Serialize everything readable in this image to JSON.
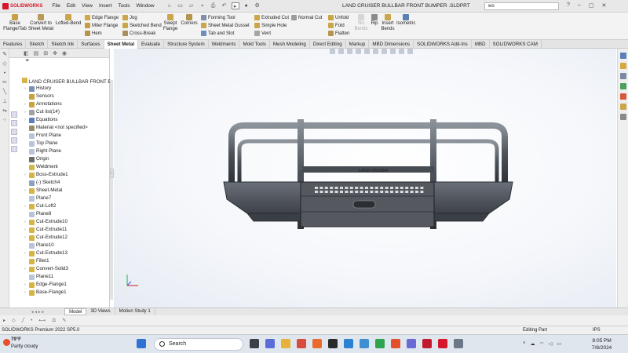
{
  "app": {
    "brand": "SOLIDWORKS",
    "doc_title": "LAND CRUISER BULLBAR FRONT BUMPER .SLDPRT",
    "search_placeholder": "wo"
  },
  "menu": [
    "File",
    "Edit",
    "View",
    "Insert",
    "Tools",
    "Window"
  ],
  "commands": {
    "base_flange_1": "Base",
    "base_flange_2": "Flange/Tab",
    "convert_1": "Convert to",
    "convert_2": "Sheet Metal",
    "lofted_bend": "Lofted-Bend",
    "edge_flange": "Edge Flange",
    "miter_flange": "Miter Flange",
    "hem": "Hem",
    "jog": "Jog",
    "sketched_bend": "Sketched Bend",
    "cross_break": "Cross-Break",
    "swept_flange_1": "Swept",
    "swept_flange_2": "Flange",
    "corners": "Corners",
    "forming_tool": "Forming Tool",
    "sheet_metal_gusset": "Sheet Metal Gusset",
    "tab_and_slot": "Tab and Slot",
    "extruded_cut": "Extruded Cut",
    "simple_hole": "Simple Hole",
    "vent": "Vent",
    "normal_cut": "Normal Cut",
    "unfold": "Unfold",
    "fold": "Fold",
    "flatten": "Flatten",
    "no_bends_1": "No",
    "no_bends_2": "Bends",
    "rip": "Rip",
    "insert_bends_1": "Insert",
    "insert_bends_2": "Bends",
    "isometric": "Isometric"
  },
  "tabs": [
    "Features",
    "Sketch",
    "Sketch Ink",
    "Surfaces",
    "Sheet Metal",
    "Evaluate",
    "Structure System",
    "Weldments",
    "Mold Tools",
    "Mesh Modeling",
    "Direct Editing",
    "Markup",
    "MBD Dimensions",
    "SOLIDWORKS Add-Ins",
    "MBD",
    "SOLIDWORKS CAM"
  ],
  "active_tab": "Sheet Metal",
  "tree": {
    "root": "LAND CRUISER BULLBAR FRONT B",
    "nodes": [
      {
        "label": "History",
        "arrow": "›",
        "color": "#7c8fb0"
      },
      {
        "label": "Sensors",
        "arrow": "",
        "color": "#c9a23c"
      },
      {
        "label": "Annotations",
        "arrow": "›",
        "color": "#c9a23c"
      },
      {
        "label": "Cut list(14)",
        "arrow": "›",
        "color": "#a2a2a2"
      },
      {
        "label": "Equations",
        "arrow": "›",
        "color": "#5a7dbb"
      },
      {
        "label": "Material <not specified>",
        "arrow": "",
        "color": "#9b8a6a"
      },
      {
        "label": "Front Plane",
        "arrow": "",
        "color": "#b8c4d8"
      },
      {
        "label": "Top Plane",
        "arrow": "",
        "color": "#b8c4d8"
      },
      {
        "label": "Right Plane",
        "arrow": "",
        "color": "#b8c4d8"
      },
      {
        "label": "Origin",
        "arrow": "",
        "color": "#6b6b6b"
      },
      {
        "label": "Weldment",
        "arrow": "",
        "color": "#d1b84c"
      },
      {
        "label": "Boss-Extrude1",
        "arrow": "›",
        "color": "#d6b445"
      },
      {
        "label": "(-) Sketch4",
        "arrow": "",
        "color": "#8da0c0"
      },
      {
        "label": "Sheet-Metal",
        "arrow": "›",
        "color": "#d6b445"
      },
      {
        "label": "Plane7",
        "arrow": "",
        "color": "#b8c4d8"
      },
      {
        "label": "Cut-Loft2",
        "arrow": "›",
        "color": "#d6b445"
      },
      {
        "label": "Plane8",
        "arrow": "",
        "color": "#b8c4d8"
      },
      {
        "label": "Cut-Extrude10",
        "arrow": "›",
        "color": "#d6b445"
      },
      {
        "label": "Cut-Extrude11",
        "arrow": "›",
        "color": "#d6b445"
      },
      {
        "label": "Cut-Extrude12",
        "arrow": "›",
        "color": "#d6b445"
      },
      {
        "label": "Plane10",
        "arrow": "",
        "color": "#b8c4d8"
      },
      {
        "label": "Cut-Extrude13",
        "arrow": "›",
        "color": "#d6b445"
      },
      {
        "label": "Fillet1",
        "arrow": "",
        "color": "#d6b445"
      },
      {
        "label": "Convert-Solid3",
        "arrow": "›",
        "color": "#d6b445"
      },
      {
        "label": "Plane11",
        "arrow": "",
        "color": "#b8c4d8"
      },
      {
        "label": "Edge-Flange1",
        "arrow": "›",
        "color": "#d6b445"
      },
      {
        "label": "Base-Flange1",
        "arrow": "›",
        "color": "#d6b445"
      }
    ]
  },
  "model": {
    "bumper_logo": "LAND CRUISER"
  },
  "view_tabs": [
    "Model",
    "3D Views",
    "Motion Study 1"
  ],
  "status": {
    "version": "SOLIDWORKS Premium 2022 SP5.0",
    "mode": "Editing Part",
    "units": "IPS"
  },
  "taskbar": {
    "temp": "79°F",
    "weather": "Partly cloudy",
    "search_label": "Search",
    "time": "8:05 PM",
    "date": "7/8/2024"
  },
  "colors": {
    "accent_red": "#d6162a",
    "steel": "#4a4f57"
  }
}
